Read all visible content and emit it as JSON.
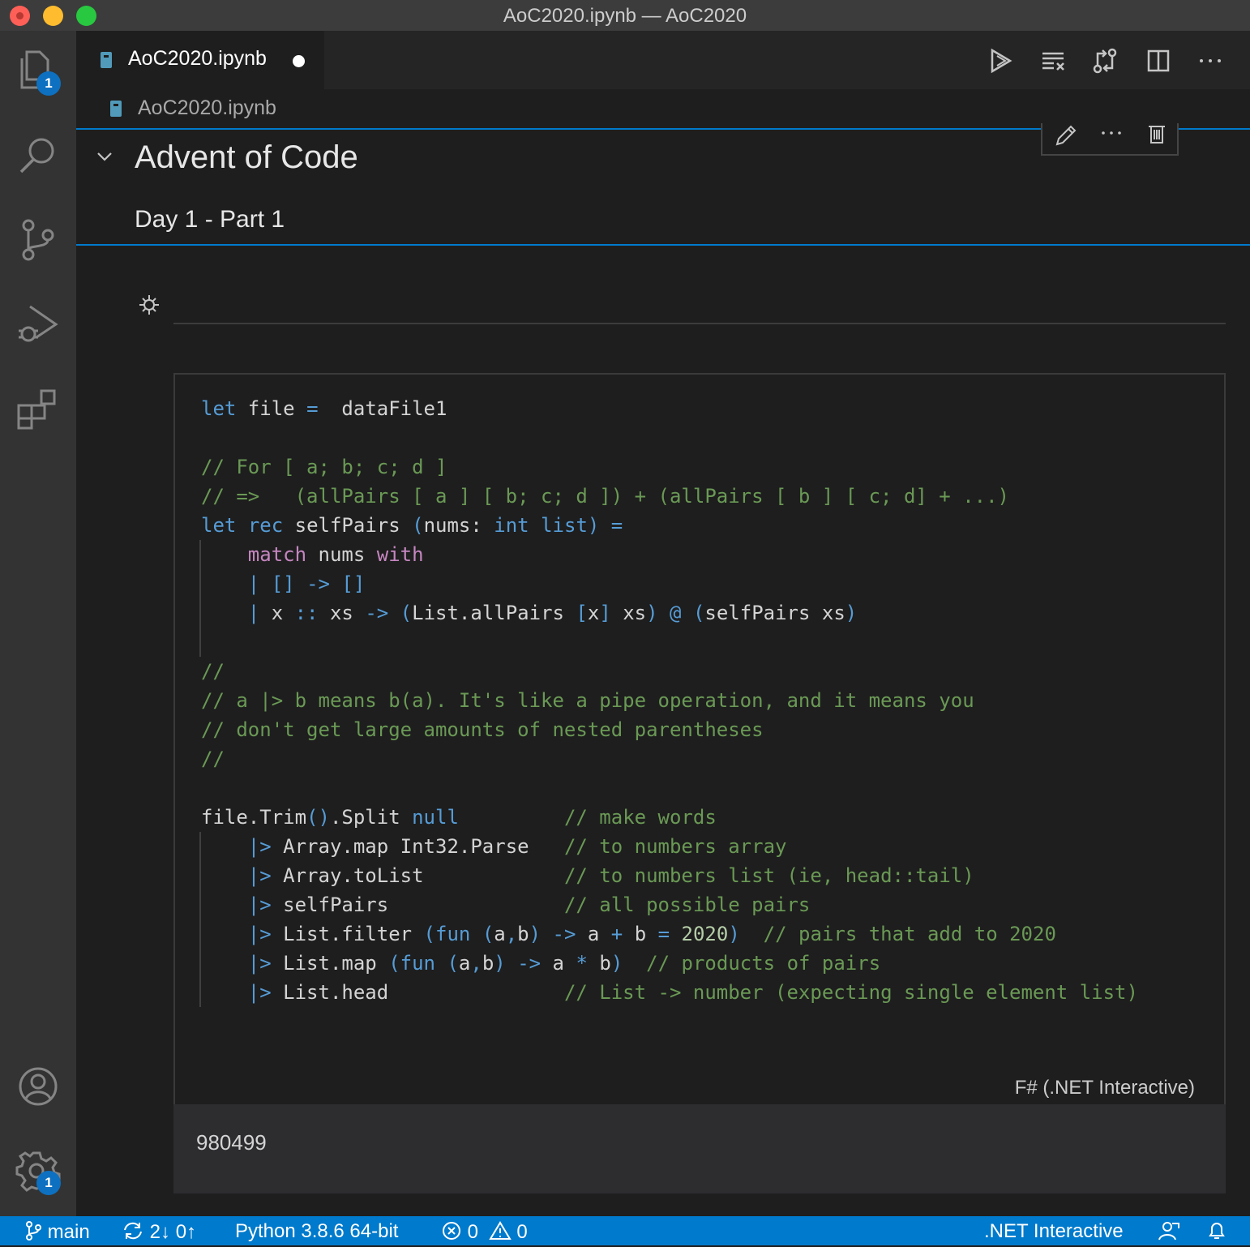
{
  "window": {
    "title": "AoC2020.ipynb — AoC2020"
  },
  "activity_bar": {
    "explorer_badge": "1",
    "settings_badge": "1"
  },
  "tab": {
    "label": "AoC2020.ipynb"
  },
  "breadcrumb": {
    "label": "AoC2020.ipynb"
  },
  "markdown_cell": {
    "heading": "Advent of Code",
    "subheading": "Day 1 - Part 1"
  },
  "code_cell": {
    "language": "F# (.NET Interactive)",
    "output": "980499",
    "lines": [
      "let file =  dataFile1",
      "",
      "// For [ a; b; c; d ]",
      "// =>   (allPairs [ a ] [ b; c; d ]) + (allPairs [ b ] [ c; d] + ...)",
      "let rec selfPairs (nums: int list) =",
      "    match nums with",
      "    | [] -> []",
      "    | x :: xs -> (List.allPairs [x] xs) @ (selfPairs xs)",
      "",
      "//",
      "// a |> b means b(a). It's like a pipe operation, and it means you",
      "// don't get large amounts of nested parentheses",
      "//",
      "",
      "file.Trim().Split null         // make words",
      "    |> Array.map Int32.Parse   // to numbers array",
      "    |> Array.toList            // to numbers list (ie, head::tail)",
      "    |> selfPairs               // all possible pairs",
      "    |> List.filter (fun (a,b) -> a + b = 2020)  // pairs that add to 2020",
      "    |> List.map (fun (a,b) -> a * b)  // products of pairs",
      "    |> List.head               // List -> number (expecting single element list)"
    ]
  },
  "status_bar": {
    "branch": "main",
    "sync": "2↓ 0↑",
    "interpreter": "Python 3.8.6 64-bit",
    "errors": "0",
    "warnings": "0",
    "kernel": ".NET Interactive"
  },
  "colors": {
    "accent": "#007acc",
    "keyword": "#569cd6",
    "comment": "#6a9955",
    "function": "#dcdcaa",
    "control": "#c586c0"
  }
}
